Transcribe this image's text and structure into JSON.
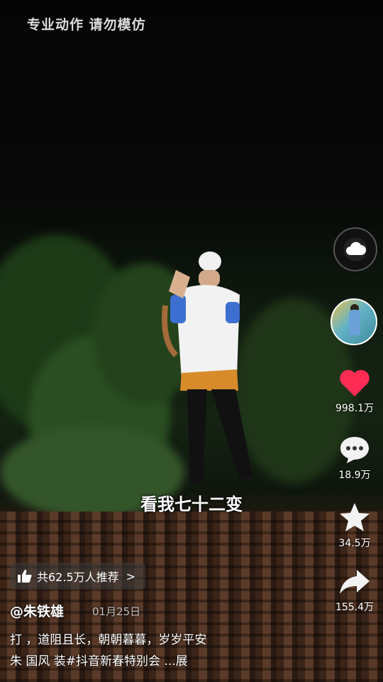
{
  "overlay": {
    "warning_text": "专业动作  请勿模仿",
    "caption": "看我七十二变"
  },
  "actions": {
    "music_icon": "cloud-music-disc-icon",
    "avatar_icon": "author-avatar",
    "like": {
      "icon": "heart-icon",
      "count": "998.1万",
      "color": "#fe2c55"
    },
    "comment": {
      "icon": "comment-bubble-icon",
      "count": "18.9万"
    },
    "favorite": {
      "icon": "star-icon",
      "count": "34.5万"
    },
    "share": {
      "icon": "share-arrow-icon",
      "count": "155.4万"
    }
  },
  "info": {
    "recommend_label": "共62.5万人推荐",
    "recommend_chevron": ">",
    "author": "@朱铁雄",
    "date": "01月25日",
    "description_line1": "打 ，道阻且长，朝朝暮暮，岁岁平安",
    "description_line2": "朱 国风 装#抖音新春特别会 ...展"
  }
}
